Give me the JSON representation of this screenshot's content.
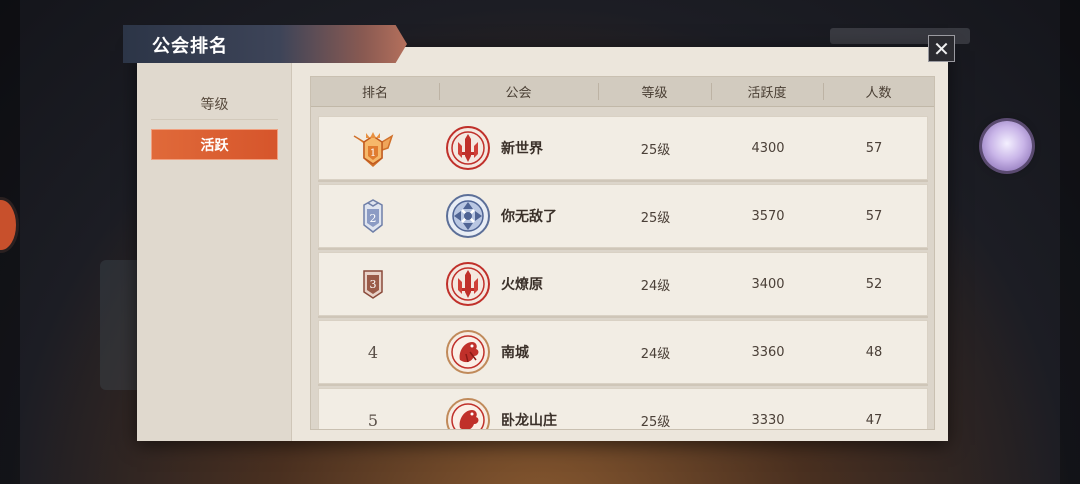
{
  "title": "公会排名",
  "sidebar": {
    "tabs": [
      {
        "label": "等级"
      },
      {
        "label": "活跃"
      }
    ]
  },
  "close_label": "✕",
  "columns": [
    "排名",
    "公会",
    "等级",
    "活跃度",
    "人数"
  ],
  "rows": [
    {
      "rank": "1",
      "name": "新世界",
      "level": "25级",
      "activity": "4300",
      "members": "57"
    },
    {
      "rank": "2",
      "name": "你无敌了",
      "level": "25级",
      "activity": "3570",
      "members": "57"
    },
    {
      "rank": "3",
      "name": "火燎原",
      "level": "24级",
      "activity": "3400",
      "members": "52"
    },
    {
      "rank": "4",
      "name": "南城",
      "level": "24级",
      "activity": "3360",
      "members": "48"
    },
    {
      "rank": "5",
      "name": "卧龙山庄",
      "level": "25级",
      "activity": "3330",
      "members": "47"
    }
  ],
  "colors": {
    "accent": "#d6552b",
    "banner": "#2c3547",
    "gold": "#e08a3a",
    "silver": "#6f7fa8",
    "bronze": "#8a4a3a",
    "emblem_red": "#c0302a"
  },
  "icons": [
    "close-icon",
    "gold-rank-badge-icon",
    "silver-rank-badge-icon",
    "bronze-rank-badge-icon",
    "sword-emblem-icon",
    "blue-crest-emblem-icon",
    "dragon-emblem-icon",
    "avatar"
  ]
}
